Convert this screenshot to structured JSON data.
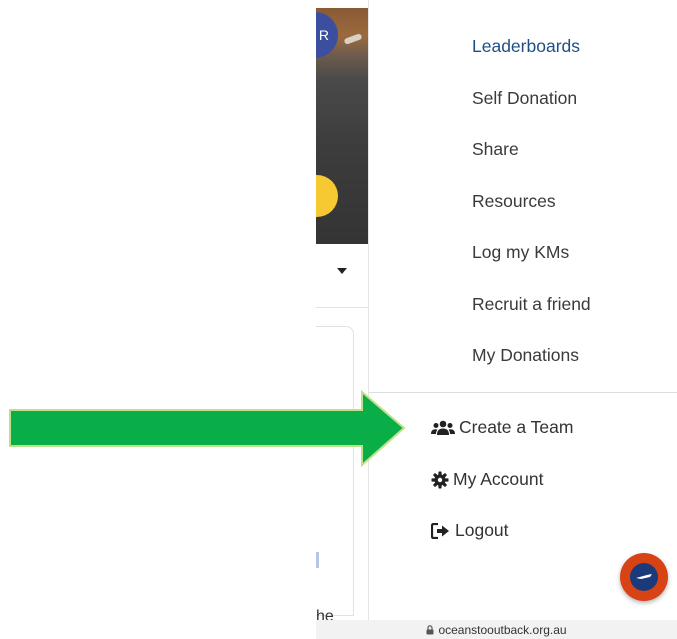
{
  "background": {
    "avatar_letter": "R",
    "partial_text": "he"
  },
  "menu": {
    "items": [
      {
        "label": "Leaderboards",
        "active": true
      },
      {
        "label": "Self Donation",
        "active": false
      },
      {
        "label": "Share",
        "active": false
      },
      {
        "label": "Resources",
        "active": false
      },
      {
        "label": "Log my KMs",
        "active": false
      },
      {
        "label": "Recruit a friend",
        "active": false
      },
      {
        "label": "My Donations",
        "active": false
      }
    ],
    "account_items": [
      {
        "label": "Create a Team",
        "icon": "users-icon"
      },
      {
        "label": "My Account",
        "icon": "gear-icon"
      },
      {
        "label": "Logout",
        "icon": "logout-icon"
      }
    ]
  },
  "browser": {
    "url": "oceanstooutback.org.au"
  },
  "colors": {
    "active_link": "#1f4f86",
    "arrow_green": "#0aae48",
    "arrow_border": "#bfe08a",
    "chat_outer": "#d84315",
    "chat_inner": "#1b3a7a",
    "yellow_fab": "#f6c933",
    "avatar_blue": "#3b4f9e"
  }
}
